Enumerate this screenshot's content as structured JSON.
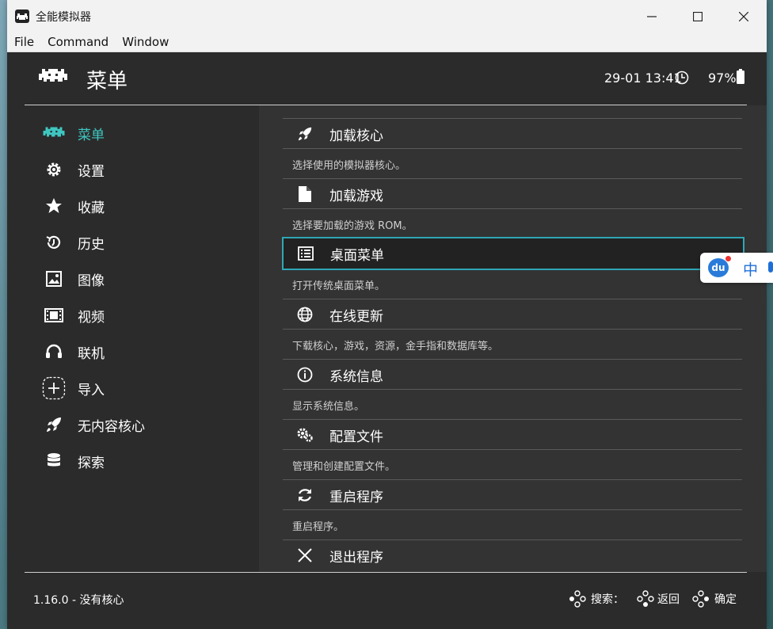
{
  "window": {
    "title": "全能模拟器",
    "menu": [
      "File",
      "Command",
      "Window"
    ]
  },
  "header": {
    "title": "菜单",
    "datetime": "29-01 13:41",
    "battery": "97%"
  },
  "sidebar": {
    "items": [
      {
        "label": "菜单",
        "icon": "invader-icon",
        "active": true
      },
      {
        "label": "设置",
        "icon": "gear-icon"
      },
      {
        "label": "收藏",
        "icon": "star-icon"
      },
      {
        "label": "历史",
        "icon": "history-icon"
      },
      {
        "label": "图像",
        "icon": "image-icon"
      },
      {
        "label": "视频",
        "icon": "film-icon"
      },
      {
        "label": "联机",
        "icon": "headset-icon"
      },
      {
        "label": "导入",
        "icon": "plus-icon"
      },
      {
        "label": "无内容核心",
        "icon": "rocket-icon"
      },
      {
        "label": "探索",
        "icon": "database-icon"
      }
    ]
  },
  "main": {
    "items": [
      {
        "label": "加载核心",
        "desc": "选择使用的模拟器核心。",
        "icon": "rocket-icon"
      },
      {
        "label": "加载游戏",
        "desc": "选择要加载的游戏 ROM。",
        "icon": "file-icon"
      },
      {
        "label": "桌面菜单",
        "desc": "打开传统桌面菜单。",
        "icon": "list-icon",
        "selected": true
      },
      {
        "label": "在线更新",
        "desc": "下载核心，游戏，资源，金手指和数据库等。",
        "icon": "globe-icon"
      },
      {
        "label": "系统信息",
        "desc": "显示系统信息。",
        "icon": "info-icon"
      },
      {
        "label": "配置文件",
        "desc": "管理和创建配置文件。",
        "icon": "gears-icon"
      },
      {
        "label": "重启程序",
        "desc": "重启程序。",
        "icon": "refresh-icon"
      },
      {
        "label": "退出程序",
        "desc": "",
        "icon": "close-icon"
      }
    ]
  },
  "footer": {
    "version": "1.16.0 - 没有核心",
    "search": "搜索：",
    "back": "返回",
    "ok": "确定"
  },
  "ime": {
    "badge": "du",
    "mode": "中"
  },
  "colors": {
    "accent": "#3ec7c0",
    "selection_border": "#2fa7b6"
  }
}
